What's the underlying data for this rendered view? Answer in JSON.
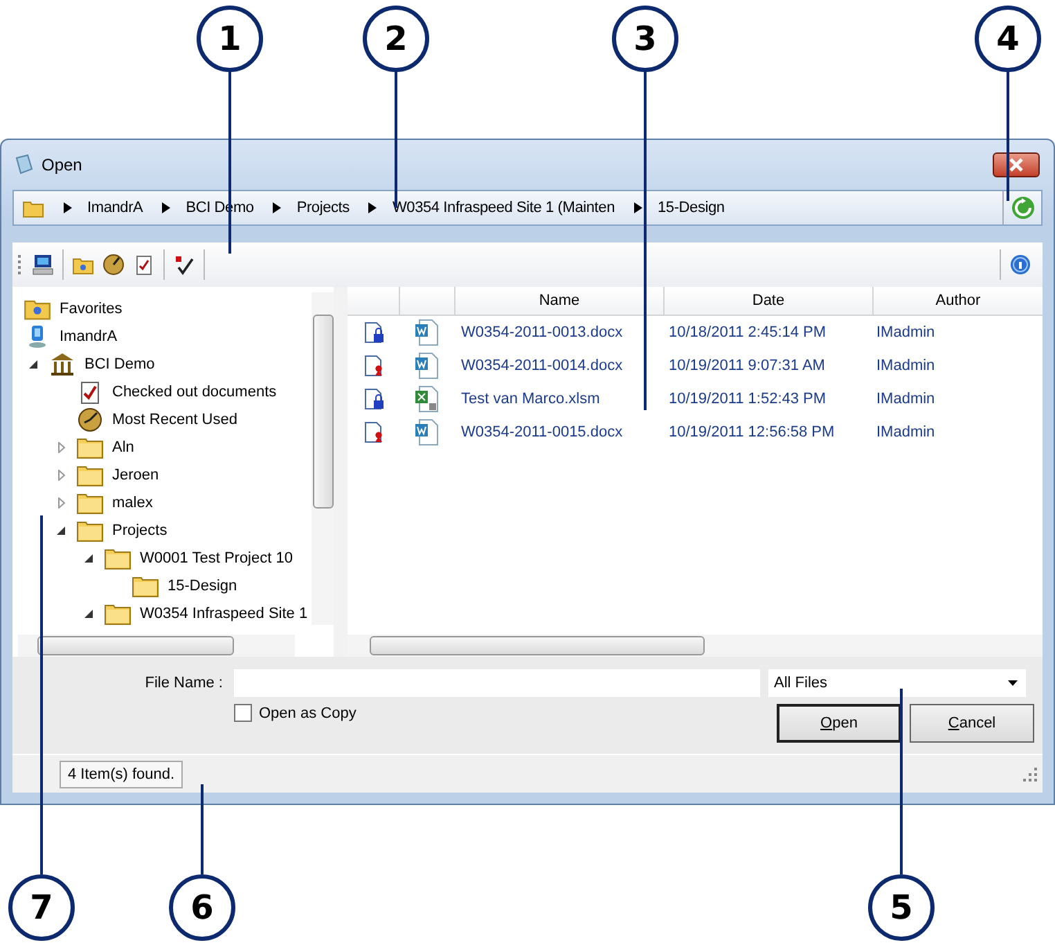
{
  "window": {
    "title": "Open"
  },
  "breadcrumb": [
    "ImandrA",
    "BCI Demo",
    "Projects",
    "W0354 Infraspeed Site 1 (Mainten",
    "15-Design"
  ],
  "tree": [
    {
      "label": "Favorites",
      "kind": "favorites"
    },
    {
      "label": "ImandrA",
      "kind": "computer"
    },
    {
      "label": "BCI Demo",
      "kind": "building",
      "expanded": true,
      "children": [
        {
          "label": "Checked out documents",
          "kind": "checklist"
        },
        {
          "label": "Most Recent Used",
          "kind": "clock"
        },
        {
          "label": "Aln",
          "kind": "folder",
          "expanded": false
        },
        {
          "label": "Jeroen",
          "kind": "folder",
          "expanded": false
        },
        {
          "label": "malex",
          "kind": "folder",
          "expanded": false
        },
        {
          "label": "Projects",
          "kind": "folder",
          "expanded": true,
          "children": [
            {
              "label": "W0001 Test Project 10",
              "kind": "folder",
              "expanded": true,
              "children": [
                {
                  "label": "15-Design",
                  "kind": "folder"
                }
              ]
            },
            {
              "label": "W0354 Infraspeed Site 1",
              "kind": "folder",
              "expanded": true
            }
          ]
        }
      ]
    }
  ],
  "table": {
    "columns": [
      "Name",
      "Date",
      "Author"
    ],
    "rows": [
      {
        "checked_out": false,
        "kind": "word",
        "name": "W0354-2011-0013.docx",
        "date": "10/18/2011 2:45:14 PM",
        "author": "IMadmin"
      },
      {
        "checked_out": true,
        "kind": "word",
        "name": "W0354-2011-0014.docx",
        "date": "10/19/2011 9:07:31 AM",
        "author": "IMadmin"
      },
      {
        "checked_out": false,
        "kind": "excel",
        "name": "Test van Marco.xlsm",
        "date": "10/19/2011 1:52:43 PM",
        "author": "IMadmin"
      },
      {
        "checked_out": true,
        "kind": "word",
        "name": "W0354-2011-0015.docx",
        "date": "10/19/2011 12:56:58 PM",
        "author": "IMadmin"
      }
    ]
  },
  "file_name": {
    "label": "File Name :"
  },
  "filter": {
    "value": "All Files"
  },
  "open_as_copy": {
    "label": "Open as Copy",
    "checked": false
  },
  "buttons": [
    {
      "label": "Open",
      "default": true
    },
    {
      "label": "Cancel",
      "default": false
    }
  ],
  "status_bar": "4 Item(s) found.",
  "callouts": [
    "1",
    "2",
    "3",
    "4",
    "7",
    "6",
    "5"
  ]
}
